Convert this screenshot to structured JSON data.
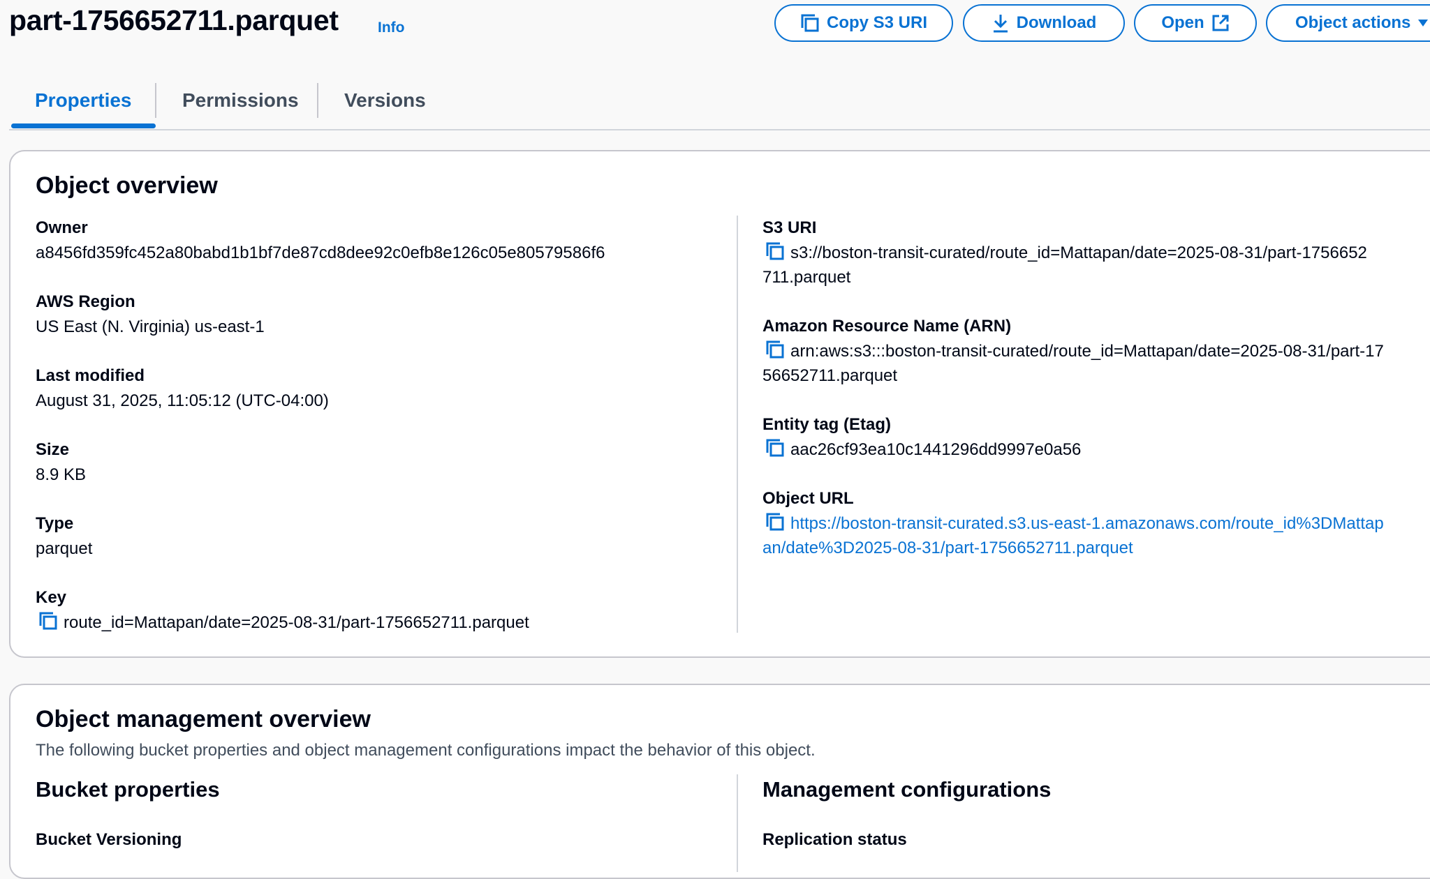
{
  "header": {
    "title": "part-1756652711.parquet",
    "info": "Info",
    "buttons": {
      "copy_s3_uri": "Copy S3 URI",
      "download": "Download",
      "open": "Open",
      "object_actions": "Object actions"
    }
  },
  "tabs": [
    {
      "label": "Properties",
      "active": true
    },
    {
      "label": "Permissions",
      "active": false
    },
    {
      "label": "Versions",
      "active": false
    }
  ],
  "overview": {
    "heading": "Object overview",
    "left": [
      {
        "label": "Owner",
        "value": "a8456fd359fc452a80babd1b1bf7de87cd8dee92c0efb8e126c05e80579586f6"
      },
      {
        "label": "AWS Region",
        "value": "US East (N. Virginia) us-east-1"
      },
      {
        "label": "Last modified",
        "value": "August 31, 2025, 11:05:12 (UTC-04:00)"
      },
      {
        "label": "Size",
        "value": "8.9 KB"
      },
      {
        "label": "Type",
        "value": "parquet"
      },
      {
        "label": "Key",
        "value": "route_id=Mattapan/date=2025-08-31/part-1756652711.parquet"
      }
    ],
    "right": [
      {
        "label": "S3 URI",
        "line1": "s3://boston-transit-curated/route_id=Mattapan/date=2025-08-31/part-1756652",
        "line2": "711.parquet"
      },
      {
        "label": "Amazon Resource Name (ARN)",
        "line1": "arn:aws:s3:::boston-transit-curated/route_id=Mattapan/date=2025-08-31/part-17",
        "line2": "56652711.parquet"
      },
      {
        "label": "Entity tag (Etag)",
        "line1": "aac26cf93ea10c1441296dd9997e0a56"
      },
      {
        "label": "Object URL",
        "line1": "https://boston-transit-curated.s3.us-east-1.amazonaws.com/route_id%3DMattap",
        "line2": "an/date%3D2025-08-31/part-1756652711.parquet"
      }
    ]
  },
  "management": {
    "heading": "Object management overview",
    "description": "The following bucket properties and object management configurations impact the behavior of this object.",
    "bucket_properties": "Bucket properties",
    "bucket_versioning": "Bucket Versioning",
    "management_configurations": "Management configurations",
    "replication_status": "Replication status"
  },
  "colors": {
    "accent": "#0972d3",
    "text": "#000716",
    "border": "#c6c6cd",
    "background": "#f9f9f9"
  }
}
